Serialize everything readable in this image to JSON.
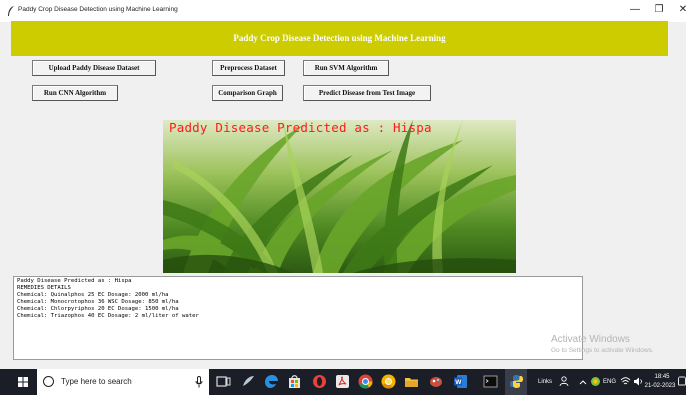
{
  "window": {
    "title": "Paddy Crop Disease Detection using Machine Learning",
    "minimize_glyph": "—",
    "maximize_glyph": "❐",
    "close_glyph": "✕"
  },
  "banner": {
    "title": "Paddy Crop Disease Detection using Machine Learning",
    "color": "#cccc00"
  },
  "buttons": {
    "upload": "Upload Paddy Disease Dataset",
    "preprocess": "Preprocess Dataset",
    "svm": "Run SVM Algorithm",
    "cnn": "Run CNN Algorithm",
    "graph": "Comparison Graph",
    "predict": "Predict Disease from Test Image"
  },
  "image": {
    "overlay_text": "Paddy Disease Predicted as : Hispa",
    "overlay_color": "#ff1a1a"
  },
  "output": {
    "lines": [
      "Paddy Disease Predicted as : Hispa",
      "REMEDIES DETAILS",
      "Chemical: Quinalphos 25 EC Dosage: 2000 ml/ha",
      "Chemical: Monocrotophos 36 WSC Dosage: 850 ml/ha",
      "Chemical: Chlorpyriphos 20 EC Dosage: 1500 ml/ha",
      "Chemical: Triazophos 40 EC Dosage: 2 ml/liter of water"
    ]
  },
  "watermark": {
    "line1": "Activate Windows",
    "line2": "Go to Settings to activate Windows."
  },
  "taskbar": {
    "search_placeholder": "Type here to search",
    "links_label": "Links",
    "lang": "ENG",
    "time": "18:45",
    "date": "21-02-2023",
    "icons": [
      "task-view-icon",
      "bird-app-icon",
      "edge-icon",
      "store-icon",
      "opera-icon",
      "acrobat-icon",
      "chrome-icon",
      "chrome-canary-icon",
      "file-explorer-icon",
      "paint-icon",
      "word-icon",
      "terminal-icon",
      "python-icon"
    ]
  }
}
